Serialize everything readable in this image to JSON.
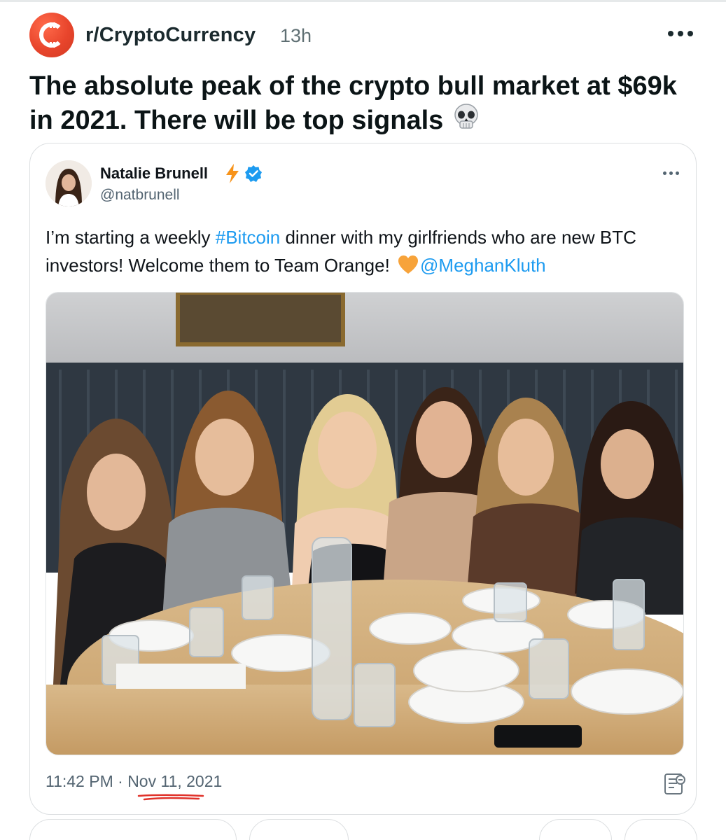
{
  "post": {
    "subreddit": "r/CryptoCurrency",
    "age": "13h",
    "title": "The absolute peak of the crypto bull market at $69k in 2021. There will be top signals"
  },
  "tweet": {
    "author_name": "Natalie Brunell",
    "handle": "@natbrunell",
    "text_part1": "I’m starting a weekly ",
    "hashtag": "#Bitcoin",
    "text_part2": " dinner with my girlfriends who are new BTC investors! Welcome them to Team Orange! ",
    "mention": "@MeghanKluth",
    "time": "11:42 PM · ",
    "date": "Nov 11, 2021",
    "photo_alt": "six women seated at a restaurant table"
  },
  "colors": {
    "subreddit_icon": "#e8452c",
    "link_blue": "#1d9bf0",
    "verified_blue": "#1d9bf0",
    "bolt_orange": "#f7931a",
    "heart_orange": "#f7a33a",
    "underline_red": "#e0322a"
  },
  "icons": [
    "subreddit-logo-icon",
    "more-options-icon",
    "skull-emoji-icon",
    "lightning-bolt-icon",
    "verified-badge-icon",
    "orange-heart-icon",
    "qr-code-icon"
  ]
}
